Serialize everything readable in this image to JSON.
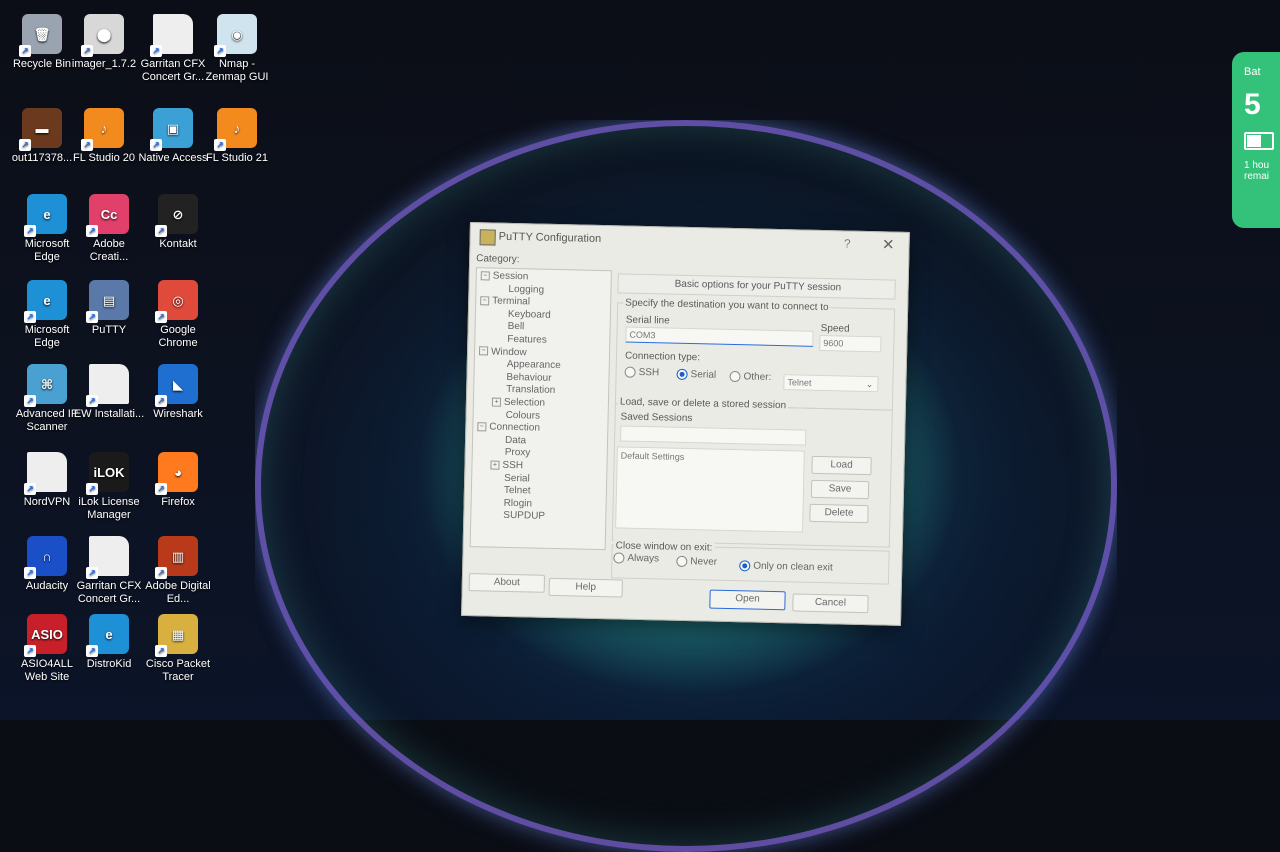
{
  "desktop": {
    "icons": [
      {
        "label": "Recycle Bin",
        "color": "#9aa4b0",
        "glyph": "🗑"
      },
      {
        "label": "imager_1.7.2",
        "color": "#d8d8d8",
        "glyph": "⬤"
      },
      {
        "label": "Garritan CFX Concert Gr...",
        "color": "#eeeeee",
        "glyph": ""
      },
      {
        "label": "Nmap - Zenmap GUI",
        "color": "#cfe4ef",
        "glyph": "◉"
      },
      {
        "label": "out117378...",
        "color": "#6b3a1e",
        "glyph": "▬"
      },
      {
        "label": "FL Studio 20",
        "color": "#f28a1e",
        "glyph": "♪"
      },
      {
        "label": "Native Access",
        "color": "#3aa0d6",
        "glyph": "▣"
      },
      {
        "label": "FL Studio 21",
        "color": "#f28a1e",
        "glyph": "♪"
      },
      {
        "label": "Microsoft Edge",
        "color": "#1e90d6",
        "glyph": "e"
      },
      {
        "label": "Adobe Creati...",
        "color": "#e0406a",
        "glyph": "Cc"
      },
      {
        "label": "Kontakt",
        "color": "#222222",
        "glyph": "⊘"
      },
      {
        "label": "Microsoft Edge",
        "color": "#1e90d6",
        "glyph": "e"
      },
      {
        "label": "PuTTY",
        "color": "#5a78a8",
        "glyph": "▤"
      },
      {
        "label": "Google Chrome",
        "color": "#e04a3a",
        "glyph": "◎"
      },
      {
        "label": "Advanced IP Scanner",
        "color": "#4aa0d0",
        "glyph": "⌘"
      },
      {
        "label": "EW Installati...",
        "color": "#eeeeee",
        "glyph": ""
      },
      {
        "label": "Wireshark",
        "color": "#1e6fd0",
        "glyph": "◣"
      },
      {
        "label": "NordVPN",
        "color": "#eeeeee",
        "glyph": ""
      },
      {
        "label": "iLok License Manager",
        "color": "#1a1a1a",
        "glyph": "iLOK"
      },
      {
        "label": "Firefox",
        "color": "#ff7a1e",
        "glyph": "◕"
      },
      {
        "label": "Audacity",
        "color": "#1a4fc8",
        "glyph": "∩"
      },
      {
        "label": "Garritan CFX Concert Gr...",
        "color": "#eeeeee",
        "glyph": ""
      },
      {
        "label": "Adobe Digital Ed...",
        "color": "#b83a1a",
        "glyph": "▥"
      },
      {
        "label": "ASIO4ALL Web Site",
        "color": "#c8202a",
        "glyph": "ASIO"
      },
      {
        "label": "DistroKid",
        "color": "#1e90d6",
        "glyph": "e"
      },
      {
        "label": "Cisco Packet Tracer",
        "color": "#d8b040",
        "glyph": "▦"
      }
    ]
  },
  "battery": {
    "title": "Bat",
    "percent": "5",
    "level": 0.55,
    "remaining": "1 hou remai"
  },
  "putty": {
    "title": "PuTTY Configuration",
    "help_glyph": "?",
    "close_glyph": "✕",
    "category_label": "Category:",
    "tree": [
      {
        "label": "Session",
        "level": 0,
        "pm": "−"
      },
      {
        "label": "Logging",
        "level": 1
      },
      {
        "label": "Terminal",
        "level": 0,
        "pm": "−"
      },
      {
        "label": "Keyboard",
        "level": 1
      },
      {
        "label": "Bell",
        "level": 1
      },
      {
        "label": "Features",
        "level": 1
      },
      {
        "label": "Window",
        "level": 0,
        "pm": "−"
      },
      {
        "label": "Appearance",
        "level": 1
      },
      {
        "label": "Behaviour",
        "level": 1
      },
      {
        "label": "Translation",
        "level": 1
      },
      {
        "label": "Selection",
        "level": 1,
        "pm": "+"
      },
      {
        "label": "Colours",
        "level": 1
      },
      {
        "label": "Connection",
        "level": 0,
        "pm": "−"
      },
      {
        "label": "Data",
        "level": 1
      },
      {
        "label": "Proxy",
        "level": 1
      },
      {
        "label": "SSH",
        "level": 1,
        "pm": "+"
      },
      {
        "label": "Serial",
        "level": 1
      },
      {
        "label": "Telnet",
        "level": 1
      },
      {
        "label": "Rlogin",
        "level": 1
      },
      {
        "label": "SUPDUP",
        "level": 1
      }
    ],
    "panel_header": "Basic options for your PuTTY session",
    "destination_label": "Specify the destination you want to connect to",
    "serial_line_label": "Serial line",
    "serial_line_value": "COM3",
    "speed_label": "Speed",
    "speed_value": "9600",
    "connection_type_label": "Connection type:",
    "conn_ssh": "SSH",
    "conn_serial": "Serial",
    "conn_other": "Other:",
    "other_value": "Telnet",
    "sessions_group_label": "Load, save or delete a stored session",
    "saved_sessions_label": "Saved Sessions",
    "saved_sessions_value": "",
    "session_list": [
      "Default Settings"
    ],
    "load_button": "Load",
    "save_button": "Save",
    "delete_button": "Delete",
    "close_on_exit_label": "Close window on exit:",
    "exit_always": "Always",
    "exit_never": "Never",
    "exit_clean": "Only on clean exit",
    "about_button": "About",
    "help_button": "Help",
    "open_button": "Open",
    "cancel_button": "Cancel"
  }
}
